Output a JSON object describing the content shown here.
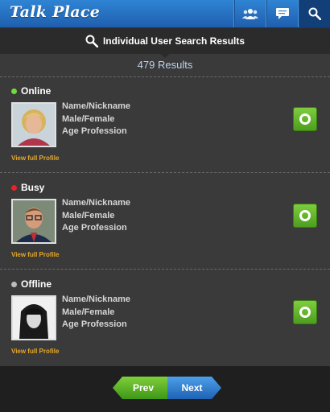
{
  "app": {
    "title": "Talk Place"
  },
  "header": {
    "tabs": [
      {
        "icon": "people-icon"
      },
      {
        "icon": "chat-icon"
      },
      {
        "icon": "search-icon",
        "active": true
      }
    ]
  },
  "subheader": {
    "title": "Individual User Search Results",
    "icon": "search-icon"
  },
  "results": {
    "count_text": "479 Results"
  },
  "entries": [
    {
      "status": "Online",
      "status_color": "#6fdc3a",
      "name": "Name/Nickname",
      "gender": "Male/Female",
      "age_profession": "Age Profession",
      "link": "View full Profile",
      "photo": "avatar-blonde-woman"
    },
    {
      "status": "Busy",
      "status_color": "#e3242b",
      "name": "Name/Nickname",
      "gender": "Male/Female",
      "age_profession": "Age Profession",
      "link": "View full Profile",
      "photo": "avatar-man-glasses"
    },
    {
      "status": "Offline",
      "status_color": "#bdbdbd",
      "name": "Name/Nickname",
      "gender": "Male/Female",
      "age_profession": "Age Profession",
      "link": "View full Profile",
      "photo": "avatar-dark-hair-woman"
    }
  ],
  "pagination": {
    "prev": "Prev",
    "next": "Next"
  },
  "colors": {
    "header_blue": "#2f84d4",
    "link_orange": "#e7a92a",
    "go_green": "#5fb52a",
    "next_blue": "#2a78c8"
  }
}
